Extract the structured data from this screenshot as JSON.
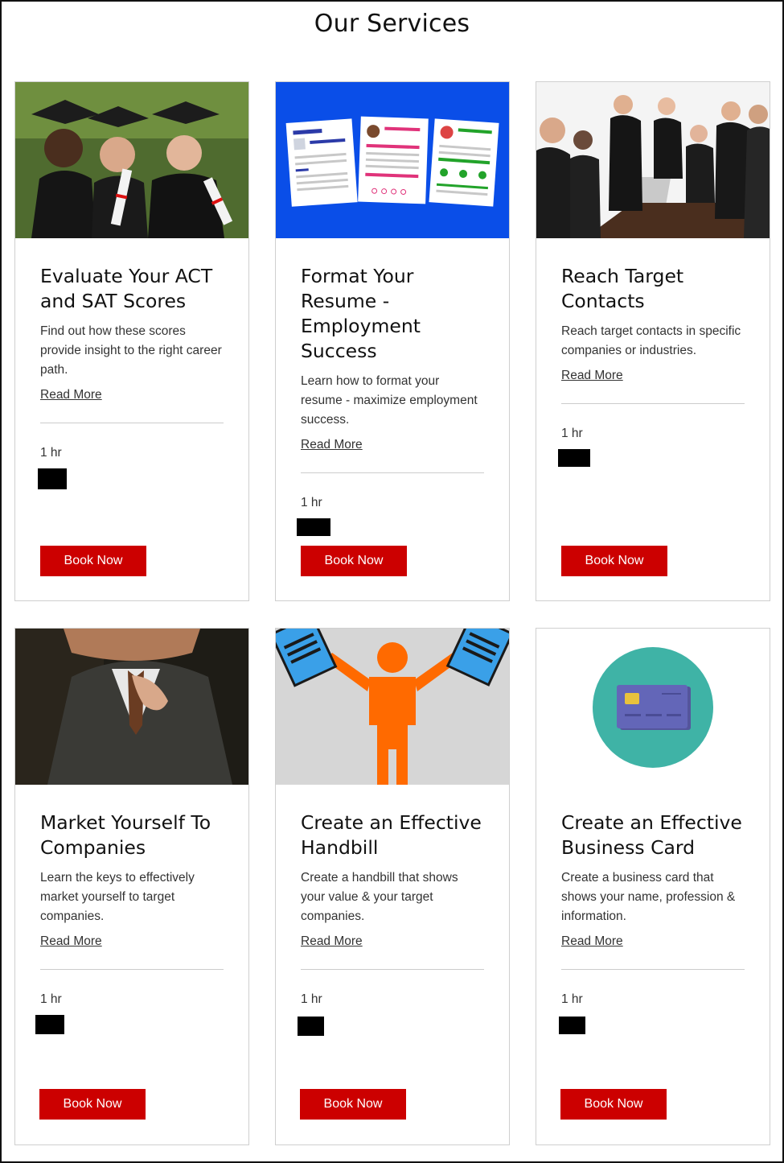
{
  "page": {
    "title": "Our Services"
  },
  "services": [
    {
      "title": "Evaluate Your ACT and SAT Scores",
      "description": "Find out how these scores provide insight to the right career path.",
      "read_more": "Read More",
      "duration": "1 hr",
      "book_label": "Book Now",
      "image": "graduates-photo"
    },
    {
      "title": "Format Your Resume - Employment Success",
      "description": "Learn how to format your resume - maximize employment success.",
      "read_more": "Read More",
      "duration": "1 hr",
      "book_label": "Book Now",
      "image": "resume-illustration"
    },
    {
      "title": "Reach Target Contacts",
      "description": "Reach target contacts in specific companies or industries.",
      "read_more": "Read More",
      "duration": "1 hr",
      "book_label": "Book Now",
      "image": "business-meeting-photo"
    },
    {
      "title": "Market Yourself To Companies",
      "description": "Learn the keys to effectively market yourself to target companies.",
      "read_more": "Read More",
      "duration": "1 hr",
      "book_label": "Book Now",
      "image": "man-in-suit-photo"
    },
    {
      "title": "Create an Effective Handbill",
      "description": "Create a handbill that shows your value & your target companies.",
      "read_more": "Read More",
      "duration": "1 hr",
      "book_label": "Book Now",
      "image": "person-with-documents-illustration"
    },
    {
      "title": "Create an Effective Business Card",
      "description": "Create a business card that shows your name, profession & information.",
      "read_more": "Read More",
      "duration": "1 hr",
      "book_label": "Book Now",
      "image": "credit-card-icon"
    }
  ],
  "colors": {
    "accent": "#cc0000",
    "price_redaction": "#000000"
  }
}
